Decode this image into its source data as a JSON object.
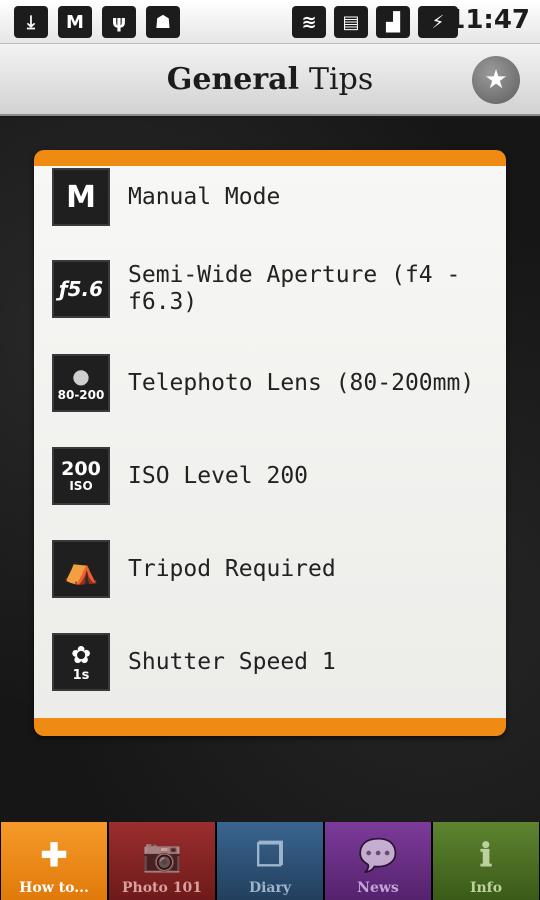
{
  "status_bar": {
    "time": "11:47",
    "icons": [
      "download-icon",
      "gmail-icon",
      "usb-icon",
      "android-icon",
      "wifi-icon",
      "sim-icon",
      "signal-icon",
      "battery-icon"
    ]
  },
  "header": {
    "title_bold": "General",
    "title_light": "Tips",
    "star_icon": "★"
  },
  "tips": [
    {
      "icon_text": "M",
      "icon_sub": "",
      "label": "Manual Mode"
    },
    {
      "icon_text": "ƒ5.6",
      "icon_sub": "",
      "label": "Semi-Wide Aperture (f4 - f6.3)"
    },
    {
      "icon_text": "●",
      "icon_sub": "80-200",
      "label": "Telephoto Lens (80-200mm)"
    },
    {
      "icon_text": "200",
      "icon_sub": "ISO",
      "label": "ISO Level 200"
    },
    {
      "icon_text": "⛺",
      "icon_sub": "",
      "label": "Tripod Required"
    },
    {
      "icon_text": "✿",
      "icon_sub": "1s",
      "label": "Shutter Speed 1"
    }
  ],
  "tabs": [
    {
      "label": "How to...",
      "icon": "✚",
      "color": "#f08a12"
    },
    {
      "label": "Photo 101",
      "icon": "📷",
      "color": "#8a2222"
    },
    {
      "label": "Diary",
      "icon": "❐",
      "color": "#2c4f72"
    },
    {
      "label": "News",
      "icon": "💬",
      "color": "#6a2f86"
    },
    {
      "label": "Info",
      "icon": "ℹ",
      "color": "#4c6e24"
    }
  ]
}
